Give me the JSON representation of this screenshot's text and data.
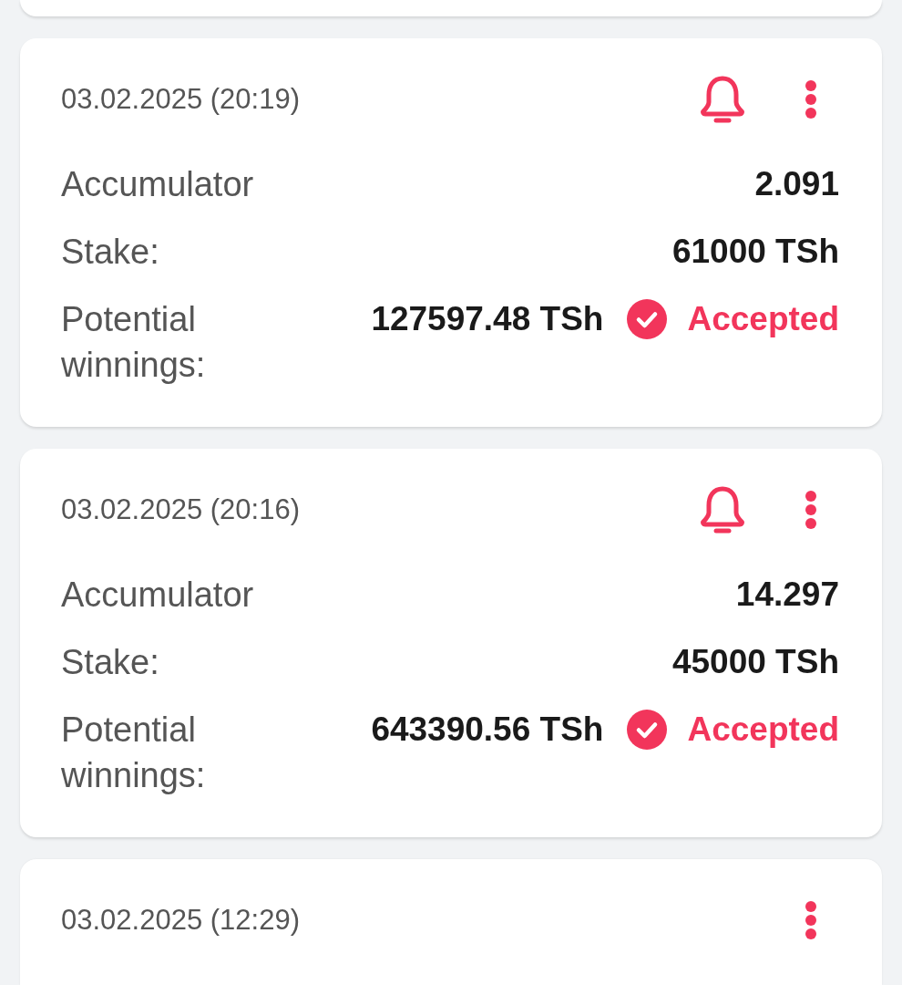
{
  "bets": [
    {
      "datetime": "03.02.2025 (20:19)",
      "notifications": true,
      "rows": [
        {
          "label": "Accumulator",
          "value": "2.091"
        },
        {
          "label": "Stake:",
          "value": "61000 TSh"
        },
        {
          "label": "Potential winnings:",
          "value": "127597.48 TSh",
          "status": {
            "kind": "accepted",
            "label": "Accepted"
          }
        }
      ]
    },
    {
      "datetime": "03.02.2025 (20:16)",
      "notifications": true,
      "rows": [
        {
          "label": "Accumulator",
          "value": "14.297"
        },
        {
          "label": "Stake:",
          "value": "45000 TSh"
        },
        {
          "label": "Potential winnings:",
          "value": "643390.56 TSh",
          "status": {
            "kind": "accepted",
            "label": "Accepted"
          }
        }
      ]
    },
    {
      "datetime": "03.02.2025 (12:29)",
      "notifications": false
    }
  ]
}
